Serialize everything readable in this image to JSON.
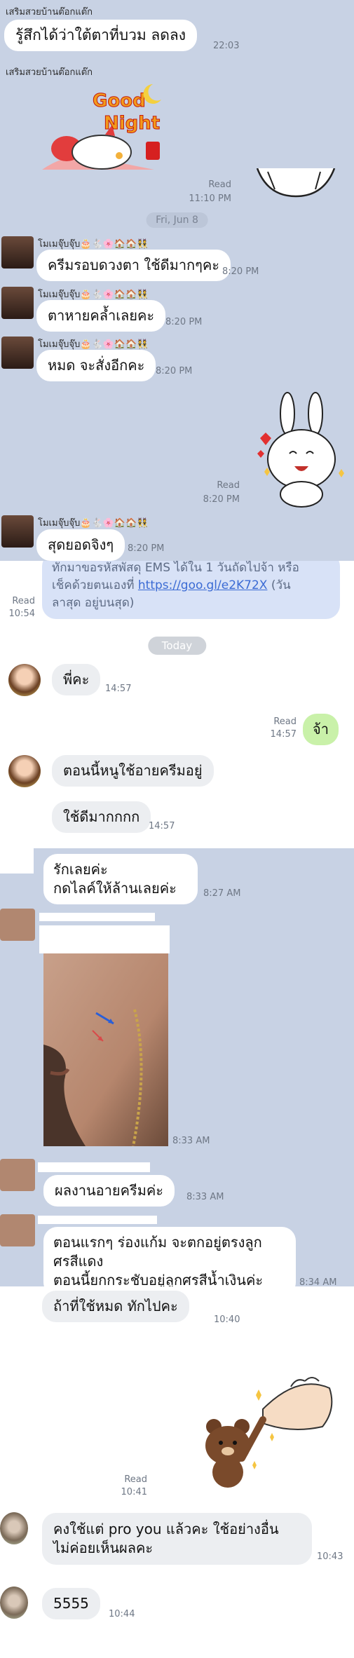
{
  "messages": {
    "m1_name": "เสริมสวยบ้านต๊อกแต๊ก",
    "m1_text": "รู้สึกได้ว่าใต้ตาที่บวม ลดลง",
    "m1_time": "22:03",
    "m2_name": "เสริมสวยบ้านต๊อกแต๊ก",
    "sticker_good": "Good",
    "sticker_night": "Night",
    "m2_read": "Read",
    "m2_time": "11:10 PM",
    "date_1": "Fri, Jun 8",
    "user_name": "โมเมจุ๊บจุ๊บ🎂🐇🌸🏠🏠👯",
    "m3_text": "ครีมรอบดวงตา ใช้ดีมากๆคะ",
    "m3_time": "8:20 PM",
    "m4_text": "ตาหายคล้ำเลยคะ",
    "m4_time": "8:20 PM",
    "m5_text": "หมด จะสั่งอีกคะ",
    "m5_time": "8:20 PM",
    "m6_read": "Read",
    "m6_time": "8:20 PM",
    "m7_text": "สุดยอดจิงๆ",
    "m7_time": "8:20 PM",
    "m8_read": "Read",
    "m8_time": "10:54",
    "m8_line1": "ทักมาขอรหัสพัสดุ EMS ได้ใน 1 วันถัดไปจ้า หรือ",
    "m8_line2a": "เช็คด้วยตนเองที่ ",
    "m8_link": "https://goo.gl/e2K72X",
    "m8_line2b": " (วัน",
    "m8_line3": "ลาสุด อยู่บนสุด)",
    "date_2": "Today",
    "m9_text": "พี่คะ",
    "m9_time": "14:57",
    "m10_read": "Read",
    "m10_time": "14:57",
    "m10_text": "จ้า",
    "m11_text": "ตอนนี้หนูใช้อายครีมอยู่",
    "m12_text": "ใช้ดีมากกกก",
    "m12_time": "14:57",
    "m13_line1": "รักเลยค่ะ",
    "m13_line2": "กดไลค์ให้ล้านเลยค่ะ",
    "m13_time": "8:27 AM",
    "m14_time": "8:33 AM",
    "m15_text": "ผลงานอายครีมค่ะ",
    "m15_time": "8:33 AM",
    "m16_line1": "ตอนแรกๆ ร่องแก้ม จะตกอยู่ตรงลูก",
    "m16_line2": "ศรสีแดง",
    "m16_line3": "ตอนนี้ยกกระชับอยู่ลูกศรสีน้ำเงินค่ะ",
    "m16_time": "8:34 AM",
    "m17_text": "ถ้าที่ใช้หมด ทักไปคะ",
    "m17_time": "10:40",
    "m18_read": "Read",
    "m18_time": "10:41",
    "m19_line1": "คงใช้แต่ pro you แล้วคะ ใช้อย่างอื่น",
    "m19_line2": "ไม่ค่อยเห็นผลคะ",
    "m19_time": "10:43",
    "m20_text": "5555",
    "m20_time": "10:44"
  },
  "colors": {
    "chat_bg_blue": "#c8d2e4",
    "bubble_white": "#ffffff",
    "bubble_green": "#c9f1a9",
    "link": "#3b6bd4"
  }
}
